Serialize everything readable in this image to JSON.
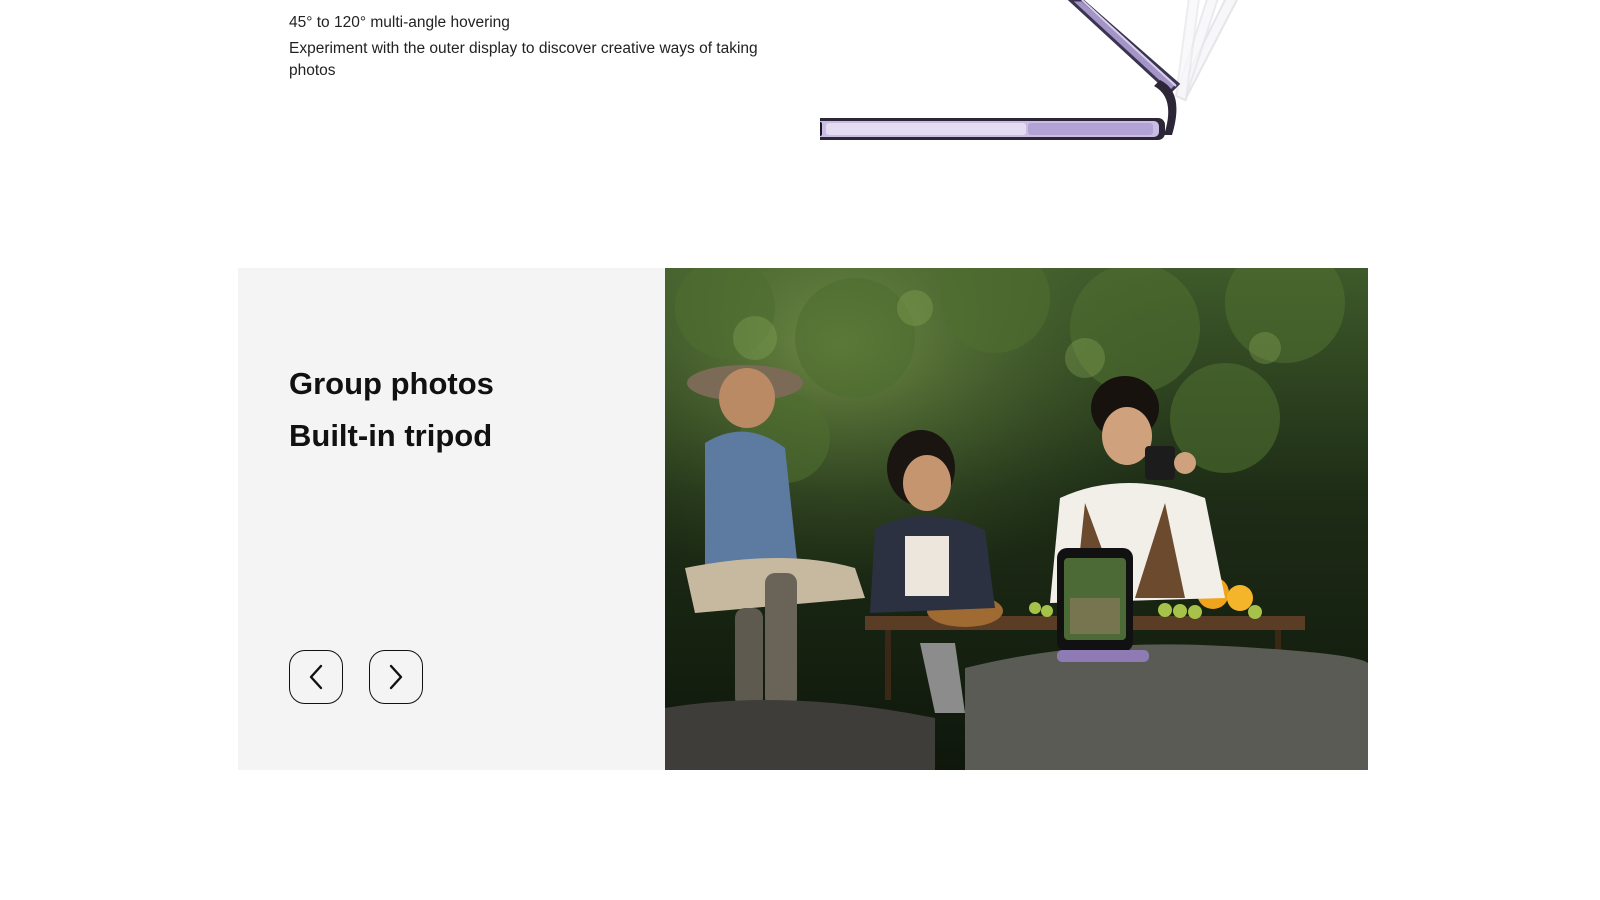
{
  "hover_section": {
    "title": "45° to 120° multi-angle hovering",
    "description": "Experiment with the outer display to discover creative ways of taking photos",
    "image_alt": "flip-phone-folding-angles"
  },
  "tripod_card": {
    "headline_1": "Group photos",
    "headline_2": "Built-in tripod",
    "photo_subject": "group-picnic-with-phone-on-rock",
    "prev_icon": "chevron-left-icon",
    "next_icon": "chevron-right-icon"
  },
  "colors": {
    "card_background": "#f4f4f4",
    "phone_purple": "#8e7bb3",
    "text": "#111111"
  }
}
